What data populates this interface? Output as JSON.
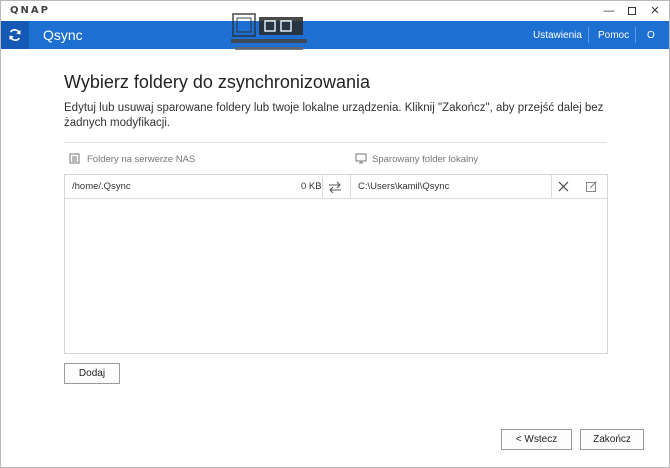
{
  "titlebar": {
    "brand": "QNAP",
    "minimize_glyph": "—",
    "close_glyph": "✕"
  },
  "header": {
    "app_title": "Qsync",
    "settings_label": "Ustawienia",
    "help_label": "Pomoc",
    "user_label": "O",
    "accent_color": "#1e6fd2"
  },
  "page": {
    "heading": "Wybierz foldery do zsynchronizowania",
    "description": "Edytuj lub usuwaj sparowane foldery lub twoje lokalne urządzenia. Kliknij \"Zakończ\", aby przejść dalej bez żadnych modyfikacji."
  },
  "columns": {
    "nas_label": "Foldery na serwerze NAS",
    "local_label": "Sparowany folder lokalny"
  },
  "rows": [
    {
      "nas_path": "/home/.Qsync",
      "size": "0 KB",
      "local_path": "C:\\Users\\kamil\\Qsync"
    }
  ],
  "buttons": {
    "add": "Dodaj",
    "back": "< Wstecz",
    "finish": "Zakończ"
  },
  "icons": {
    "sync": "sync-icon",
    "server": "server-icon",
    "monitor": "monitor-icon",
    "swap": "swap-arrows-icon",
    "remove": "close-icon",
    "edit": "edit-icon"
  }
}
